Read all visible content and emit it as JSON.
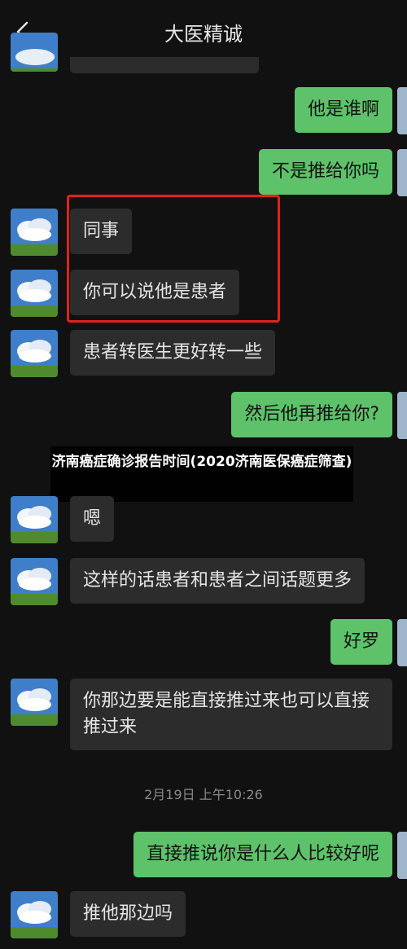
{
  "header": {
    "title": "大医精诚"
  },
  "messages": [
    {
      "side": "out",
      "text": "他是谁啊"
    },
    {
      "side": "out",
      "text": "不是推给你吗"
    },
    {
      "side": "in",
      "text": "同事"
    },
    {
      "side": "in",
      "text": "你可以说他是患者"
    },
    {
      "side": "in",
      "text": "患者转医生更好转一些"
    },
    {
      "side": "out",
      "text": "然后他再推给你?"
    },
    {
      "side": "in",
      "text": "嗯"
    },
    {
      "side": "in",
      "text": "这样的话患者和患者之间话题更多"
    },
    {
      "side": "out",
      "text": "好罗"
    },
    {
      "side": "in",
      "text": "你那边要是能直接推过来也可以直接推过来"
    },
    {
      "side": "out",
      "text": "直接推说你是什么人比较好呢"
    },
    {
      "side": "in",
      "text": "推他那边吗"
    }
  ],
  "timestamp": "2月19日 上午10:26",
  "overlay": {
    "text": "济南癌症确诊报告时间(2020济南医保癌症筛查)"
  },
  "colors": {
    "background": "#111111",
    "incoming_bubble": "#2c2c2c",
    "outgoing_bubble": "#5ec26a",
    "highlight": "#e0221c"
  }
}
